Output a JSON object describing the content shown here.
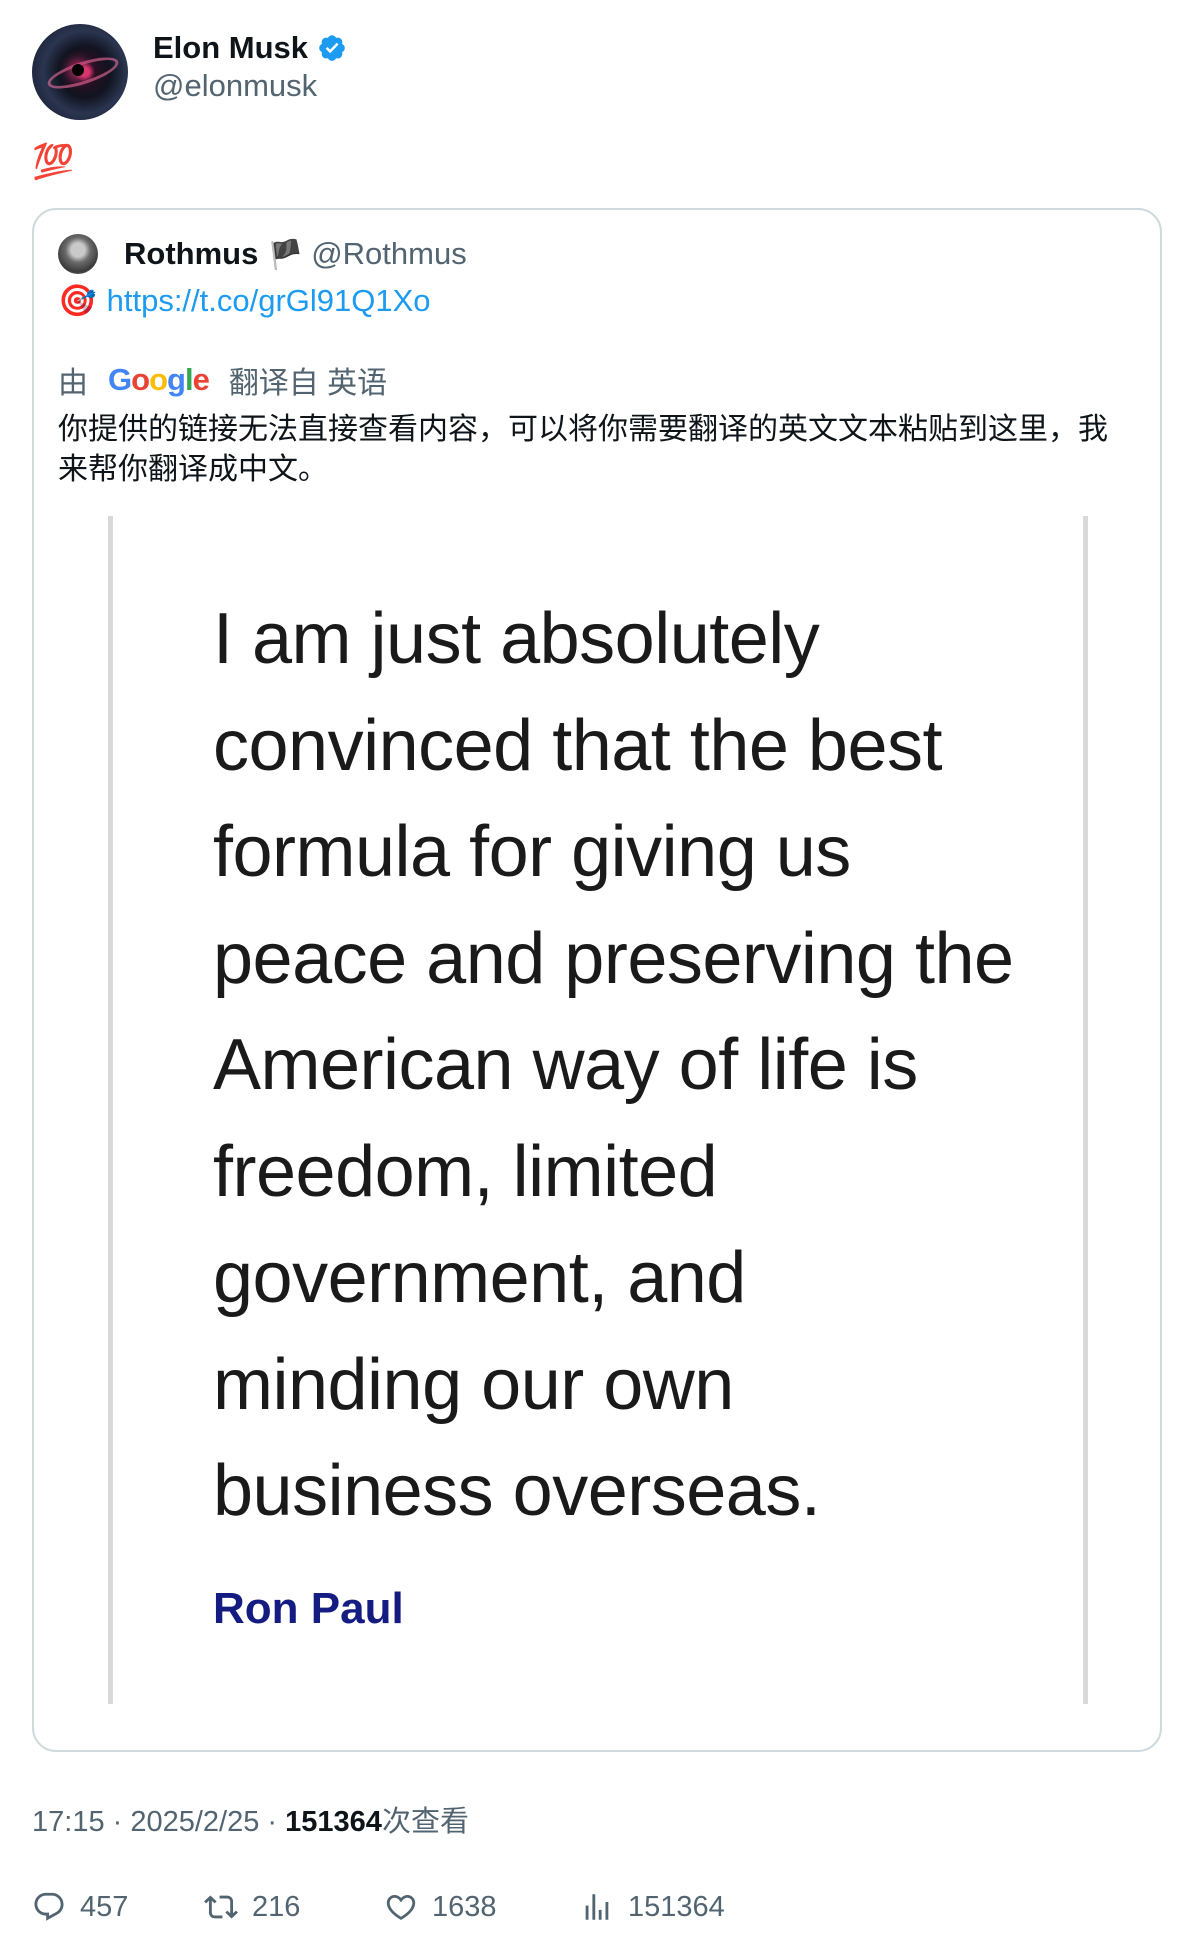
{
  "author": {
    "name": "Elon Musk",
    "handle": "@elonmusk",
    "verified_color": "#1d9bf0"
  },
  "tweet": {
    "text": "💯"
  },
  "quoted": {
    "name": "Rothmus",
    "flag": "🏴",
    "handle": "@Rothmus",
    "pin_emoji": "🎯",
    "link": "https://t.co/grGl91Q1Xo",
    "translate": {
      "prefix": "由",
      "provider_letters": [
        "G",
        "o",
        "o",
        "g",
        "l",
        "e"
      ],
      "suffix": "翻译自 英语"
    },
    "translated_text": "你提供的链接无法直接查看内容，可以将你需要翻译的英文文本粘贴到这里，我来帮你翻译成中文。",
    "image": {
      "quote_lines": [
        "I am just absolutely",
        "convinced that the best",
        "formula for giving us",
        "peace and preserving the",
        "American way of life is",
        "freedom, limited",
        "government, and",
        "minding our own",
        "business overseas."
      ],
      "attribution": "Ron Paul"
    }
  },
  "meta": {
    "time": "17:15",
    "sep": " · ",
    "date": "2025/2/25",
    "views_count": "151364",
    "views_label": "次查看"
  },
  "actions": {
    "replies": "457",
    "retweets": "216",
    "likes": "1638",
    "views": "151364"
  },
  "icons": [
    "verified-badge-icon",
    "reply-icon",
    "retweet-icon",
    "like-icon",
    "views-icon"
  ]
}
